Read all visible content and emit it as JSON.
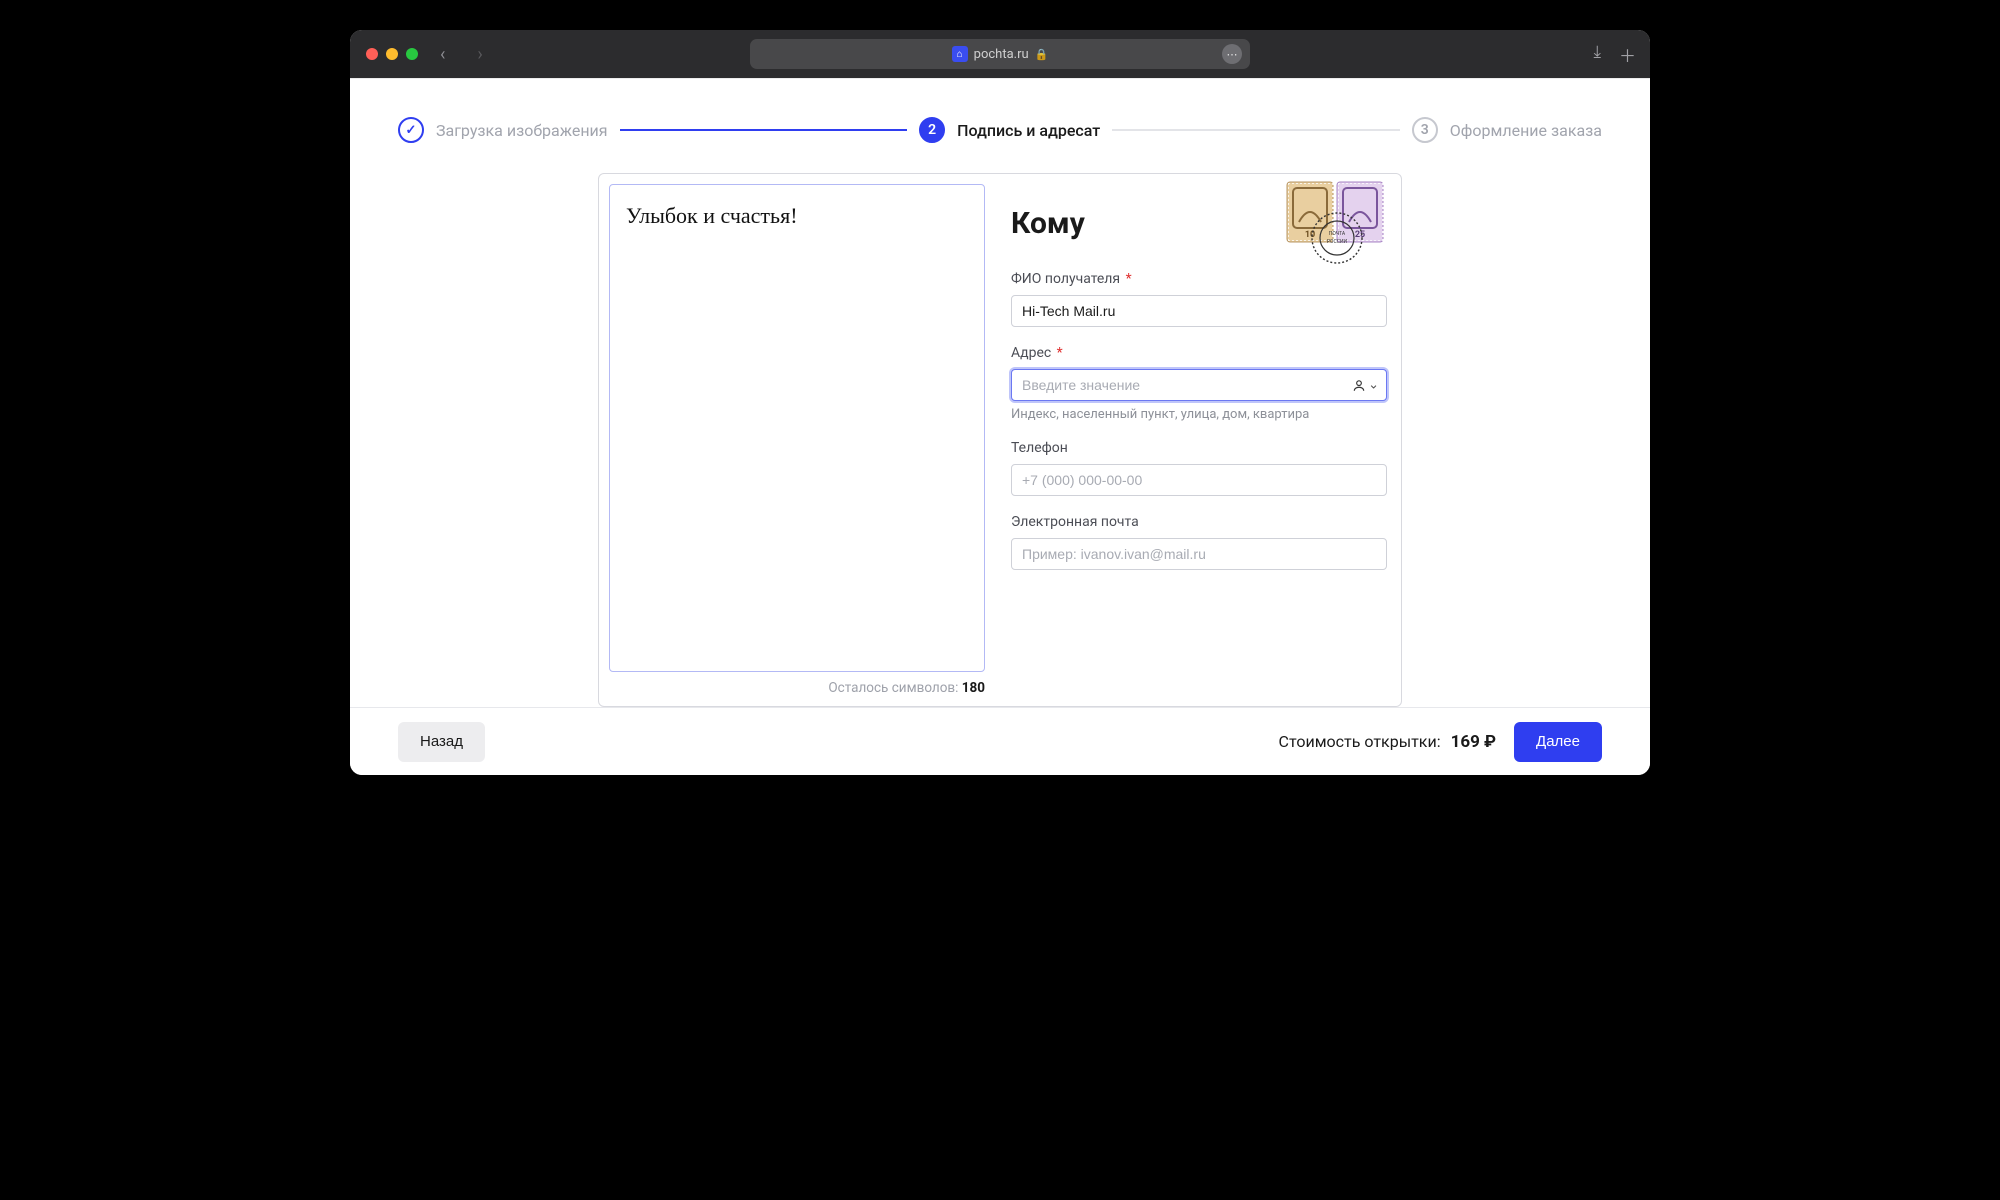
{
  "browser": {
    "url_host": "pochta.ru"
  },
  "stepper": {
    "step1": {
      "label": "Загрузка изображения"
    },
    "step2": {
      "num": "2",
      "label": "Подпись и адресат"
    },
    "step3": {
      "num": "3",
      "label": "Оформление заказа"
    }
  },
  "message": {
    "text": "Улыбок и счастья!",
    "chars_prefix": "Осталось символов: ",
    "chars_left": "180"
  },
  "form": {
    "heading": "Кому",
    "name": {
      "label": "ФИО получателя",
      "value": "Hi-Tech Mail.ru"
    },
    "address": {
      "label": "Адрес",
      "placeholder": "Введите значение",
      "hint": "Индекс, населенный пункт, улица, дом, квартира"
    },
    "phone": {
      "label": "Телефон",
      "placeholder": "+7 (000) 000-00-00"
    },
    "email": {
      "label": "Электронная почта",
      "placeholder": "Пример: ivanov.ivan@mail.ru"
    }
  },
  "footer": {
    "back": "Назад",
    "price_label": "Стоимость открытки:",
    "price_value": "169 ₽",
    "next": "Далее"
  }
}
